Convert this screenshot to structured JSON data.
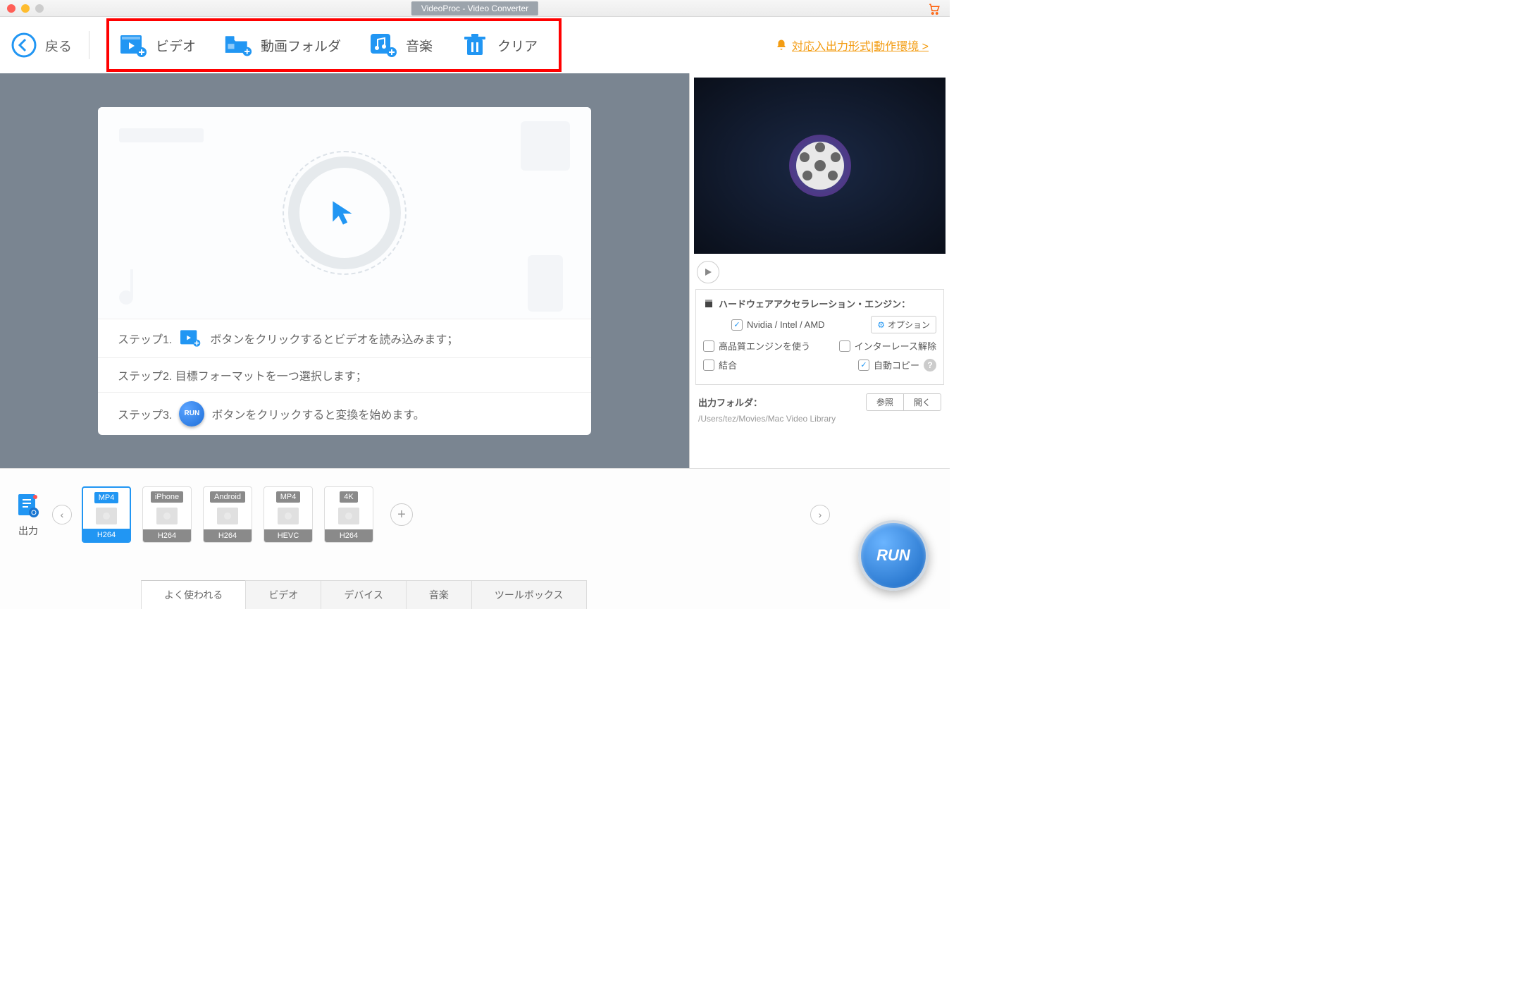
{
  "title": "VideoProc - Video Converter",
  "back_label": "戻る",
  "toolbar": {
    "video": "ビデオ",
    "folder": "動画フォルダ",
    "music": "音楽",
    "clear": "クリア"
  },
  "notif_link": "対応入出力形式|動作環境 >",
  "steps": {
    "s1_pre": "ステップ1.",
    "s1_post": "ボタンをクリックするとビデオを読み込みます；",
    "s2": "ステップ2.  目標フォーマットを一つ選択します；",
    "s3_pre": "ステップ3.",
    "s3_post": "ボタンをクリックすると変換を始めます。",
    "run_mini": "RUN"
  },
  "right": {
    "hw_title": "ハードウェアアクセラレーション・エンジン：",
    "hw_vendors": "Nvidia /  Intel / AMD",
    "options_btn": "オプション",
    "hq_engine": "高品質エンジンを使う",
    "deinterlace": "インターレース解除",
    "merge": "結合",
    "autocopy": "自動コピー",
    "out_folder_label": "出力フォルダ：",
    "browse": "参照",
    "open": "開く",
    "path": "/Users/tez/Movies/Mac Video Library"
  },
  "output_label": "出力",
  "presets": [
    {
      "top": "MP4",
      "bot": "H264",
      "active": true
    },
    {
      "top": "iPhone",
      "bot": "H264",
      "active": false
    },
    {
      "top": "Android",
      "bot": "H264",
      "active": false
    },
    {
      "top": "MP4",
      "bot": "HEVC",
      "active": false
    },
    {
      "top": "4K",
      "bot": "H264",
      "active": false
    }
  ],
  "tabs": [
    "よく使われる",
    "ビデオ",
    "デバイス",
    "音楽",
    "ツールボックス"
  ],
  "run_label": "RUN"
}
